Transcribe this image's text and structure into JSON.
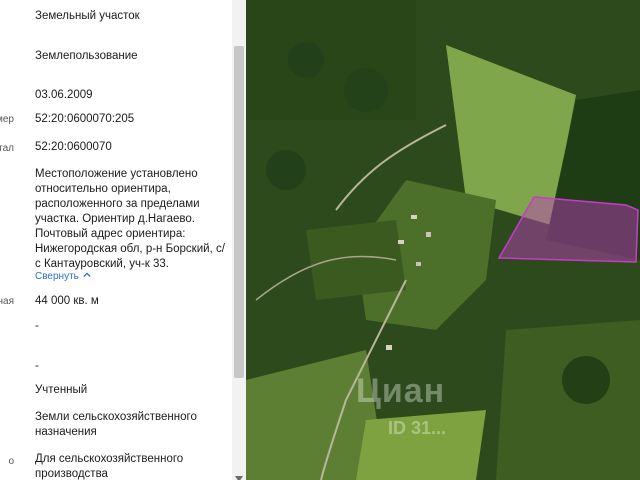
{
  "details": {
    "rows": [
      {
        "label": "",
        "value": "Земельный участок"
      },
      {
        "label": "",
        "value": "Землепользование"
      },
      {
        "label": "",
        "value": "03.06.2009"
      },
      {
        "label": "мер",
        "value": "52:20:0600070:205"
      },
      {
        "label": "ртал",
        "value": "52:20:0600070"
      },
      {
        "label": "",
        "value": "Местоположение установлено\nотносительно ориентира,\nрасположенного за пределами\nучастка. Ориентир д.Нагаево.\nПочтовый адрес ориентира:\nНижегородская обл, р-н Борский, с/\nс Кантауровский, уч-к 33."
      },
      {
        "label": "ная",
        "value": "44 000 кв. м"
      },
      {
        "label": "",
        "value": "-"
      },
      {
        "label": "",
        "value": "-"
      },
      {
        "label": "",
        "value": "Учтенный"
      },
      {
        "label": "",
        "value": "Земли сельскохозяйственного\nназначения"
      },
      {
        "label": "о",
        "value": "Для сельскохозяйственного\nпроизводства"
      }
    ],
    "collapse_label": "Свернуть"
  },
  "map": {
    "watermark": "Циан",
    "watermark_id": "ID 31...",
    "parcel_color": "#c63cc8"
  },
  "icons": {
    "collapse": "chevron-up-icon",
    "scroll_down": "arrow-down-icon"
  }
}
